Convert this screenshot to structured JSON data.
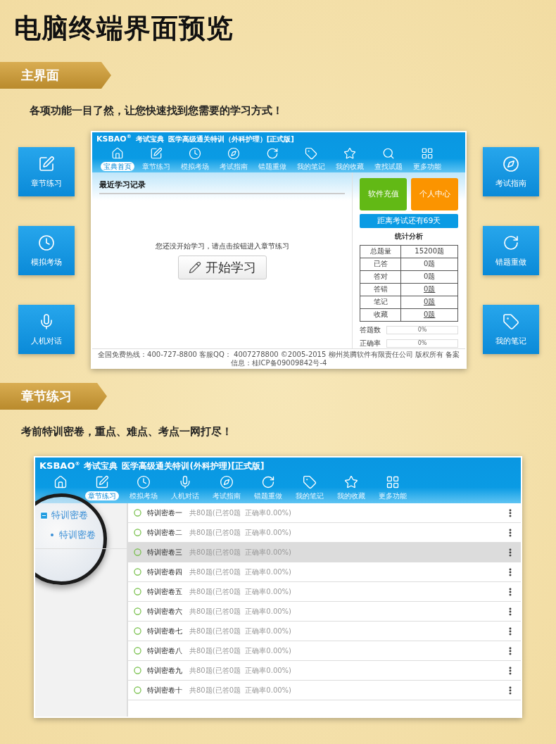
{
  "page_title": "电脑终端界面预览",
  "main_section": {
    "ribbon": "主界面",
    "subtitle": "各项功能一目了然，让您快速找到您需要的学习方式！",
    "left_features": [
      {
        "kind": "edit",
        "label": "章节练习"
      },
      {
        "kind": "clock",
        "label": "模拟考场"
      },
      {
        "kind": "mic",
        "label": "人机对话"
      }
    ],
    "right_features": [
      {
        "kind": "compass",
        "label": "考试指南"
      },
      {
        "kind": "redo",
        "label": "错题重做"
      },
      {
        "kind": "tag",
        "label": "我的笔记"
      }
    ],
    "app": {
      "brand": "KSBAO$^{®}$",
      "brand_name": "考试宝典",
      "title": "医学高级通关特训（外科护理）[正式版]",
      "nav": [
        {
          "kind": "home",
          "label": "宝典首页",
          "selected": true
        },
        {
          "kind": "edit",
          "label": "章节练习",
          "selected": false
        },
        {
          "kind": "clock",
          "label": "模拟考场",
          "selected": false
        },
        {
          "kind": "compass",
          "label": "考试指南",
          "selected": false
        },
        {
          "kind": "redo",
          "label": "错题重做",
          "selected": false
        },
        {
          "kind": "tag",
          "label": "我的笔记",
          "selected": false
        },
        {
          "kind": "star",
          "label": "我的收藏",
          "selected": false
        },
        {
          "kind": "search",
          "label": "查找试题",
          "selected": false
        },
        {
          "kind": "grid",
          "label": "更多功能",
          "selected": false
        }
      ],
      "recent": {
        "heading": "最近学习记录",
        "message": "您还没开始学习，请点击按钮进入章节练习",
        "start_button": "开始学习"
      },
      "side": {
        "recharge": "软件充值",
        "profile": "个人中心",
        "countdown": "距离考试还有69天",
        "stats_title": "统计分析",
        "stats": [
          {
            "label": "总题量",
            "value": "15200题",
            "kind": "plain"
          },
          {
            "label": "已答",
            "value": "0题",
            "kind": "plain"
          },
          {
            "label": "答对",
            "value": "0题",
            "kind": "plain"
          },
          {
            "label": "答错",
            "value": "0题",
            "kind": "link"
          },
          {
            "label": "笔记",
            "value": "0题",
            "kind": "link"
          },
          {
            "label": "收藏",
            "value": "0题",
            "kind": "link"
          }
        ],
        "progress": [
          {
            "label": "答题数",
            "reading": "0%",
            "level": 0
          },
          {
            "label": "正确率",
            "reading": "0%",
            "level": 0
          }
        ]
      },
      "footer": "全国免费热线：400-727-8800  客服QQ： 4007278800   ©2005-2015  柳州英腾软件有限责任公司 版权所有  备案信息：桂ICP备09009842号-4"
    }
  },
  "chapter_section": {
    "ribbon": "章节练习",
    "subtitle": "考前特训密卷，重点、难点、考点一网打尽！",
    "app": {
      "brand": "KSBAO$^{®}$",
      "brand_name": "考试宝典",
      "title": "医学高级通关特训(外科护理)[正式版]",
      "nav": [
        {
          "kind": "home"
        },
        {
          "kind": "edit",
          "label": "章节练习",
          "selected": true
        },
        {
          "kind": "clock",
          "label": "模拟考场",
          "selected": false
        },
        {
          "kind": "mic",
          "label": "人机对话",
          "selected": false
        },
        {
          "kind": "compass",
          "label": "考试指南",
          "selected": false
        },
        {
          "kind": "redo",
          "label": "错题重做",
          "selected": false
        },
        {
          "kind": "tag",
          "label": "我的笔记",
          "selected": false
        },
        {
          "kind": "star",
          "label": "我的收藏",
          "selected": false
        },
        {
          "kind": "grid",
          "label": "更多功能",
          "selected": false
        }
      ],
      "tree": [
        {
          "label": "特训密卷",
          "expanded": true,
          "children": [
            {
              "label": "特训密卷"
            }
          ]
        }
      ],
      "papers": [
        {
          "name": "特训密卷一",
          "info": "共80题(已答0题  正确率0.00%)",
          "selected": false
        },
        {
          "name": "特训密卷二",
          "info": "共80题(已答0题  正确率0.00%)",
          "selected": false
        },
        {
          "name": "特训密卷三",
          "info": "共80题(已答0题  正确率0.00%)",
          "selected": true
        },
        {
          "name": "特训密卷四",
          "info": "共80题(已答0题  正确率0.00%)",
          "selected": false
        },
        {
          "name": "特训密卷五",
          "info": "共80题(已答0题  正确率0.00%)",
          "selected": false
        },
        {
          "name": "特训密卷六",
          "info": "共80题(已答0题  正确率0.00%)",
          "selected": false
        },
        {
          "name": "特训密卷七",
          "info": "共80题(已答0题  正确率0.00%)",
          "selected": false
        },
        {
          "name": "特训密卷八",
          "info": "共80题(已答0题  正确率0.00%)",
          "selected": false
        },
        {
          "name": "特训密卷九",
          "info": "共80题(已答0题  正确率0.00%)",
          "selected": false
        },
        {
          "name": "特训密卷十",
          "info": "共80题(已答0题  正确率0.00%)",
          "selected": false
        }
      ]
    }
  }
}
